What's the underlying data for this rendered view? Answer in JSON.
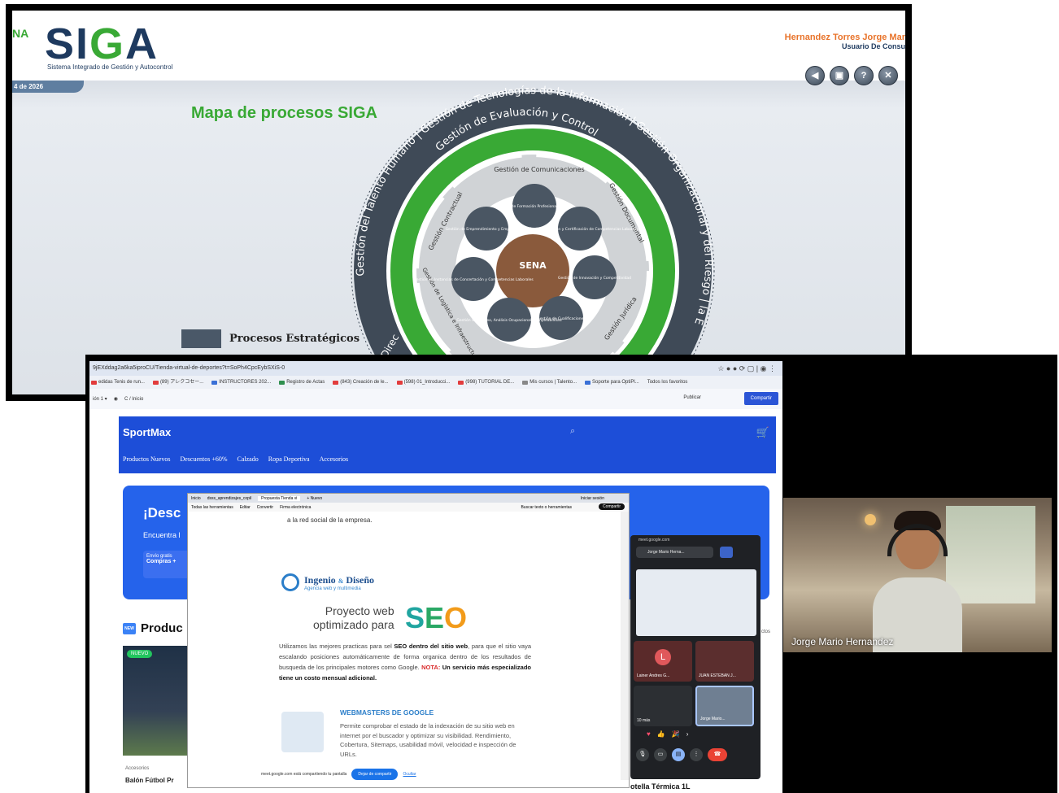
{
  "siga": {
    "logo_text_1": "SI",
    "logo_text_2": "G",
    "logo_text_3": "A",
    "subtitle": "Sistema Integrado de Gestión y Autocontrol",
    "leaf_text": "NA",
    "date": "4 de 2026",
    "user_name": "Hernandez Torres Jorge Mar",
    "user_role": "Usuario De Consu",
    "buttons": [
      "back",
      "forward",
      "help",
      "close"
    ],
    "map_title": "Mapa de procesos SIGA",
    "legend_label": "Procesos Estratégicos",
    "outer_ring_text": "Gestión del Talento Humano | Gestión de Tecnologías de la Información | Gestión Organizacional y del Riesgo | la Empresa",
    "green_ring_text": "Gestión de Evaluación y Control",
    "segments": [
      "Gestión de Comunicaciones",
      "Gestión Documental",
      "Gestión Jurídica",
      "Gestión de Logística e Infraestructura",
      "Gestión Contractual"
    ],
    "inner_processes": [
      "Gestión de Formación Profesional Integral",
      "Gestión de Evaluación y Certificación de Competencias Laborales",
      "Gestión de Innovación y Competitividad",
      "Gestión de Cualificaciones",
      "Gestión de Empleo, Análisis Ocupacional y Empleabilidad",
      "Gestión de Instancias de Concertación y Competencias Laborales",
      "Gestión de Emprendimiento y Empresarismo"
    ],
    "center_logo": "SENA",
    "partial_text": "Direc"
  },
  "browser": {
    "url": "9jEXddag2a6ka5iproCU/Tienda-virtual-de-deportes?t=SoPh4CpcEybSXiS-0",
    "bookmarks": [
      {
        "label": "edidas Tenis de run...",
        "color": "#e23c3c"
      },
      {
        "label": "(89) アレクコセー...",
        "color": "#e23c3c"
      },
      {
        "label": "INSTRUCTORES 202...",
        "color": "#3a70d6"
      },
      {
        "label": "Registro de Actas",
        "color": "#2f8f4e"
      },
      {
        "label": "(843) Creación de le...",
        "color": "#e23c3c"
      },
      {
        "label": "(598) 01_Introducci...",
        "color": "#e23c3c"
      },
      {
        "label": "(998) TUTORIAL DE...",
        "color": "#e23c3c"
      },
      {
        "label": "Mis cursos | Talento...",
        "color": "#888888"
      },
      {
        "label": "Soporte para OptiPl...",
        "color": "#3a70d6"
      }
    ],
    "bookmarks_all": "Todos los favoritos",
    "toolbar_left": "ión 1 ▾",
    "toolbar_path": "C  /  Inicio",
    "publish": "Publicar",
    "share": "Compartir"
  },
  "sportmax": {
    "brand": "SportMax",
    "nav": [
      "Productos Nuevos",
      "Descuentos +60%",
      "Calzado",
      "Ropa Deportiva",
      "Accesorios"
    ],
    "hero_title": "¡Desc",
    "hero_sub": "Encuentra l",
    "hero_box_1": "Envío gratis",
    "hero_box_2": "Compras +",
    "products_title": "Produc",
    "products_badge": "NEW",
    "card_badge": "NUEVO",
    "card_category": "Accesorios",
    "card_name": "Balón Fútbol Pr",
    "left_strip_items": [
      "00",
      "E",
      "1",
      "5"
    ]
  },
  "doc": {
    "tabs": [
      "Inicio",
      "dsss_aprendizajes_copil",
      "Propuesta Tienda vi",
      "+ Nuevo"
    ],
    "tab_right": "Iniciar sesión",
    "menu": [
      "Todas las herramientas",
      "Editar",
      "Convertir",
      "Firma electrónica"
    ],
    "menu_search": "Buscar texto o herramientas",
    "share": "Compartir",
    "top_text": "a la red social de la empresa.",
    "logo_name": "Ingenio",
    "logo_amp": "&",
    "logo_name2": "Diseño",
    "logo_tag": "Agencia web y multimedia",
    "proj_line1": "Proyecto web",
    "proj_line2": "optimizado para",
    "seo_s": "S",
    "seo_e": "E",
    "seo_o": "O",
    "para_1": "Utilizamos las mejores practicas para sel ",
    "para_bold": "SEO dentro del sitio web",
    "para_2": ", para que el sitio vaya escalando posiciones automáticamente de forma organica dentro de los resultados de busqueda de los principales motores como Google. ",
    "para_nota": "NOTA:",
    "para_3": " Un servicio más especializado tiene un costo mensual adicional.",
    "wm_title": "WEBMASTERS DE GOOGLE",
    "wm_text": "Permite comprobar el estado de la indexación de su sitio web en internet por el buscador y optimizar su visibilidad. Rendimiento, Cobertura, Sitemaps, usabilidad móvil, velocidad e inspección de URLs.",
    "meet_bar_text": "meet.google.com está compartiendo tu pantalla",
    "meet_stop": "Dejar de compartir",
    "meet_hide": "Ocultar"
  },
  "meet": {
    "url": "meet.google.com",
    "presenter": "Jorge Mario Herna...",
    "tiles": [
      {
        "name": "Lainer Andres G...",
        "initial": "L"
      },
      {
        "name": "JUAN ESTEBAN J..."
      },
      {
        "name": "10 más"
      },
      {
        "name": "Jorge Mario..."
      }
    ],
    "reactions": [
      "♥",
      "👍",
      "🎉",
      "›"
    ],
    "controls": [
      "mic",
      "camera",
      "present",
      "more",
      "end-call"
    ]
  },
  "cam": {
    "name": "Jorge Mario Hernandez"
  },
  "below_text": "otella Térmica 1L",
  "side_label": "ctos"
}
